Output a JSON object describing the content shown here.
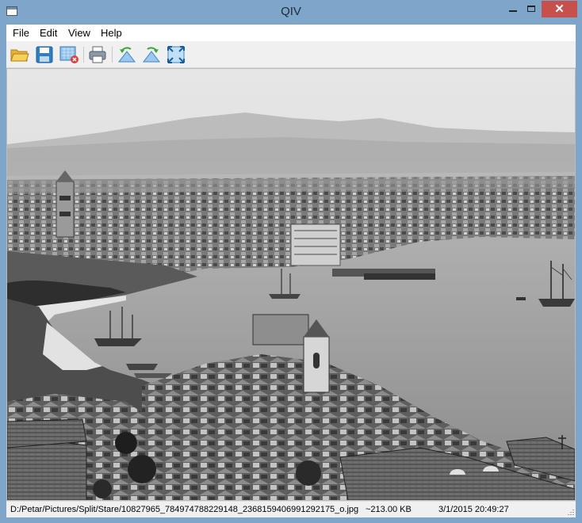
{
  "window": {
    "title": "QIV"
  },
  "window_controls": {
    "minimize": "–",
    "maximize": "□",
    "close": "✕"
  },
  "menu": {
    "items": [
      "File",
      "Edit",
      "View",
      "Help"
    ]
  },
  "toolbar": {
    "buttons": [
      {
        "icon": "open-folder-icon"
      },
      {
        "icon": "save-icon"
      },
      {
        "icon": "close-image-icon"
      },
      {
        "icon": "print-icon"
      },
      {
        "icon": "rotate-left-icon"
      },
      {
        "icon": "rotate-right-icon"
      },
      {
        "icon": "fit-to-window-icon"
      }
    ]
  },
  "image": {
    "description_alt": "Black and white photograph of a harbor town"
  },
  "status": {
    "path": "D:/Petar/Pictures/Split/Stare/10827965_784974788229148_2368159406991292175_o.jpg",
    "size": "~213.00 KB",
    "date": "3/1/2015 20:49:27"
  },
  "colors": {
    "frame": "#7ea6ca",
    "close": "#c7504d",
    "toolbar_blue": "#3b86c9"
  }
}
